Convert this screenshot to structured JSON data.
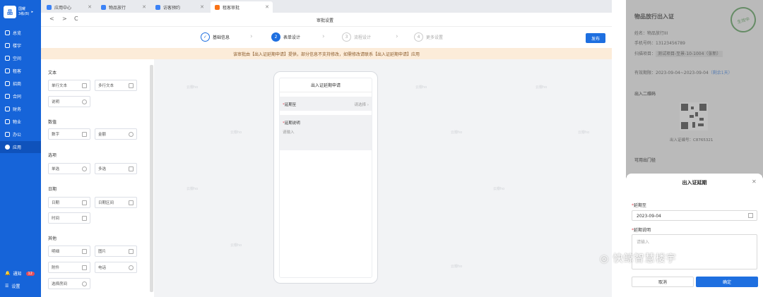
{
  "sidebar": {
    "logo_mark": "品",
    "logo_line1": "国耀",
    "logo_line2": "3栋(B)",
    "items": [
      {
        "label": "总览",
        "icon": "dashboard-icon"
      },
      {
        "label": "楼宇",
        "icon": "building-icon"
      },
      {
        "label": "空间",
        "icon": "space-icon"
      },
      {
        "label": "租客",
        "icon": "tenant-icon"
      },
      {
        "label": "招商",
        "icon": "investment-icon"
      },
      {
        "label": "合同",
        "icon": "contract-icon"
      },
      {
        "label": "财务",
        "icon": "finance-icon"
      },
      {
        "label": "物业",
        "icon": "property-icon"
      },
      {
        "label": "办公",
        "icon": "office-icon"
      },
      {
        "label": "应用",
        "icon": "app-icon"
      }
    ],
    "bottom": [
      {
        "label": "通知",
        "badge": "12"
      },
      {
        "label": "设置"
      }
    ]
  },
  "tabs": [
    {
      "label": "应用中心"
    },
    {
      "label": "物品放行"
    },
    {
      "label": "访客预约"
    },
    {
      "label": "租客审批"
    }
  ],
  "toolbar": {
    "back": "<",
    "forward": ">",
    "refresh": "C",
    "title": "审批设置"
  },
  "steps": [
    {
      "num": "✓",
      "label": "基础信息"
    },
    {
      "num": "2",
      "label": "表单设计"
    },
    {
      "num": "3",
      "label": "流程设计"
    },
    {
      "num": "4",
      "label": "更多设置"
    }
  ],
  "publish_label": "发布",
  "notice": "该审批由【出入证延期申请】提供，部分信息不支持修改，如需修改请联系【出入证延期申请】应用",
  "palette": {
    "groups": [
      {
        "title": "文本",
        "fields": [
          "单行文本",
          "多行文本",
          "说明"
        ]
      },
      {
        "title": "数值",
        "fields": [
          "数字",
          "金额"
        ]
      },
      {
        "title": "选项",
        "fields": [
          "单选",
          "多选"
        ]
      },
      {
        "title": "日期",
        "fields": [
          "日期",
          "日期区间",
          "时间"
        ]
      },
      {
        "title": "其他",
        "fields": [
          "明细",
          "图片",
          "附件",
          "电话",
          "选择房间"
        ]
      }
    ]
  },
  "watermark": "云瓣ho",
  "phone": {
    "title": "出入证延期申请",
    "field1_label": "延期至",
    "field1_placeholder": "请选择",
    "field2_label": "延期说明",
    "field2_placeholder": "请输入"
  },
  "right_panel": {
    "title": "物品放行出入证",
    "stamp": "生效中",
    "name": "姓名：物品放行III",
    "phone": "手机号码：13123456789",
    "project": "扫描项目：",
    "project_value": "测试项目-至景-10-1004（张新）",
    "validity": "有效期限：2023-09-04~2023-09-04",
    "remain": "（剩余1天）",
    "qr_title": "出入二维码",
    "cert_no": "出入证编号：C8765321",
    "gate_title": "可用出门径"
  },
  "dialog": {
    "title": "出入证延期",
    "field1_label": "延期至",
    "field1_value": "2023-09-04",
    "field2_label": "延期说明",
    "field2_placeholder": "请输入",
    "cancel": "取消",
    "confirm": "确定"
  },
  "brand_text": "快鲸智慧楼宇"
}
